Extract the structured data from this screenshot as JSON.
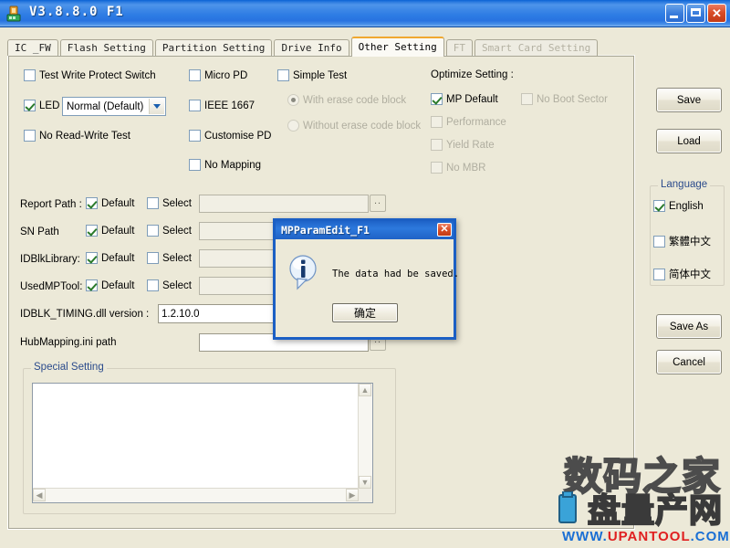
{
  "window": {
    "title": "V3.8.8.0 F1",
    "icon": "app-icon",
    "minimize_label": "Minimize",
    "maximize_label": "Maximize",
    "close_label": "Close"
  },
  "tabs": [
    {
      "label": "IC _FW",
      "state": "normal"
    },
    {
      "label": "Flash Setting",
      "state": "normal"
    },
    {
      "label": "Partition Setting",
      "state": "normal"
    },
    {
      "label": "Drive Info",
      "state": "normal"
    },
    {
      "label": "Other Setting",
      "state": "active"
    },
    {
      "label": "FT",
      "state": "disabled"
    },
    {
      "label": "Smart Card Setting",
      "state": "disabled"
    }
  ],
  "other_setting": {
    "column_left": {
      "test_write_protect_switch": {
        "label": "Test Write Protect Switch",
        "checked": false
      },
      "led": {
        "label": "LED",
        "checked": true
      },
      "led_mode": {
        "value": "Normal (Default)"
      },
      "no_read_write_test": {
        "label": "No Read-Write Test",
        "checked": false
      }
    },
    "column_mid": {
      "micro_pd": {
        "label": "Micro PD",
        "checked": false
      },
      "ieee_1667": {
        "label": "IEEE 1667",
        "checked": false
      },
      "customise_pd": {
        "label": "Customise PD",
        "checked": false
      },
      "no_mapping": {
        "label": "No Mapping",
        "checked": false
      }
    },
    "column_test": {
      "simple_test": {
        "label": "Simple Test",
        "checked": false
      },
      "with_erase_code_block": {
        "label": "With erase code block",
        "selected": true,
        "disabled": true
      },
      "without_erase_code_block": {
        "label": "Without erase code block",
        "selected": false,
        "disabled": true
      }
    },
    "optimize": {
      "title": "Optimize Setting :",
      "mp_default": {
        "label": "MP Default",
        "checked": true,
        "disabled": false
      },
      "no_boot_sector": {
        "label": "No Boot Sector",
        "checked": false,
        "disabled": true
      },
      "performance": {
        "label": "Performance",
        "checked": false,
        "disabled": true
      },
      "yield_rate": {
        "label": "Yield Rate",
        "checked": false,
        "disabled": true
      },
      "no_mbr": {
        "label": "No MBR",
        "checked": false,
        "disabled": true
      }
    },
    "paths": [
      {
        "label": "Report Path :",
        "default_label": "Default",
        "default_checked": true,
        "select_label": "Select",
        "select_checked": false,
        "value": "",
        "browse_label": "..",
        "has_browse": true
      },
      {
        "label": "SN Path",
        "default_label": "Default",
        "default_checked": true,
        "select_label": "Select",
        "select_checked": false,
        "value": "",
        "browse_label": "..",
        "has_browse": false
      },
      {
        "label": "IDBlkLibrary:",
        "default_label": "Default",
        "default_checked": true,
        "select_label": "Select",
        "select_checked": false,
        "value": "",
        "browse_label": "..",
        "has_browse": false
      },
      {
        "label": "UsedMPTool:",
        "default_label": "Default",
        "default_checked": true,
        "select_label": "Select",
        "select_checked": false,
        "value": "",
        "browse_label": "..",
        "has_browse": false
      }
    ],
    "dll_version": {
      "label": "IDBLK_TIMING.dll version :",
      "value": "1.2.10.0"
    },
    "hub_mapping": {
      "label": "HubMapping.ini path",
      "value": "",
      "browse_label": ".."
    },
    "special_setting": {
      "legend": "Special Setting",
      "value": ""
    }
  },
  "side": {
    "save": "Save",
    "load": "Load",
    "language": {
      "legend": "Language",
      "options": [
        {
          "label": "English",
          "checked": true
        },
        {
          "label": "繁體中文",
          "checked": false
        },
        {
          "label": "简体中文",
          "checked": false
        }
      ]
    },
    "save_as": "Save As",
    "cancel": "Cancel"
  },
  "dialog": {
    "title": "MPParamEdit_F1",
    "message": "The data had be saved.",
    "ok_label": "确定",
    "close_label": "x",
    "icon": "information-icon"
  },
  "watermark": {
    "line1": "数码之家",
    "line2": "盘量产网",
    "url_blue": "WWW.",
    "url_red": "UPANTOOL",
    "url_blue2": ".COM"
  },
  "colors": {
    "titlebar": "#2d79dd",
    "panel_bg": "#ece9d8",
    "accent_tab": "#f0a830",
    "legend_text": "#2b4b8c"
  }
}
